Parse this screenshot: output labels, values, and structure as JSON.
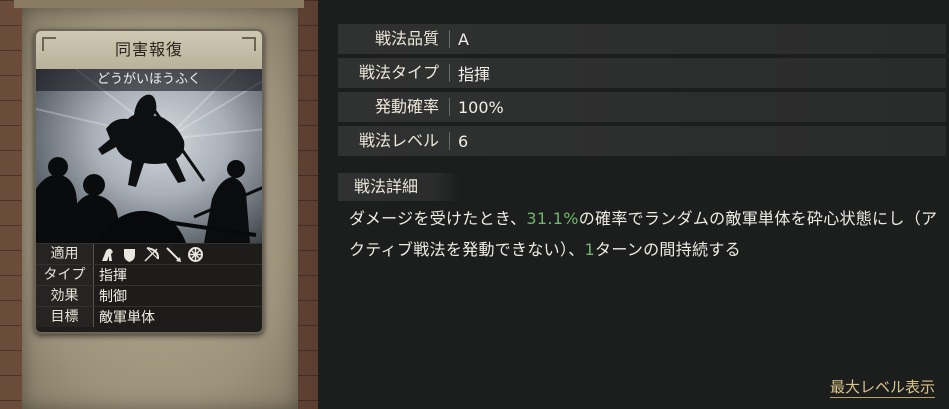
{
  "skill_card": {
    "name": "同害報復",
    "kana": "どうがいほうふく",
    "rows": {
      "suitability": {
        "label": "適用",
        "icons": [
          "cavalry-icon",
          "shield-icon",
          "bow-icon",
          "spear-icon",
          "wheel-icon"
        ]
      },
      "type": {
        "label": "タイプ",
        "value": "指揮"
      },
      "effect": {
        "label": "効果",
        "value": "制御"
      },
      "target": {
        "label": "目標",
        "value": "敵軍単体"
      }
    }
  },
  "stats": [
    {
      "label": "戦法品質",
      "value": "A"
    },
    {
      "label": "戦法タイプ",
      "value": "指揮"
    },
    {
      "label": "発動確率",
      "value": "100%"
    },
    {
      "label": "戦法レベル",
      "value": "6"
    }
  ],
  "detail": {
    "header": "戦法詳細",
    "text_1": "ダメージを受けたとき、",
    "highlight_1": "31.1%",
    "text_2": "の確率でランダムの敵軍単体を砕心状態にし（アクティブ戦法を発動できない）、",
    "highlight_2": "1",
    "text_3": "ターンの間持続する"
  },
  "max_level_link": "最大レベル表示",
  "colors": {
    "highlight": "#6fb66a",
    "link": "#d9c48c",
    "panel_bg": "#1c1d1d",
    "wood": "#6b4b39"
  }
}
